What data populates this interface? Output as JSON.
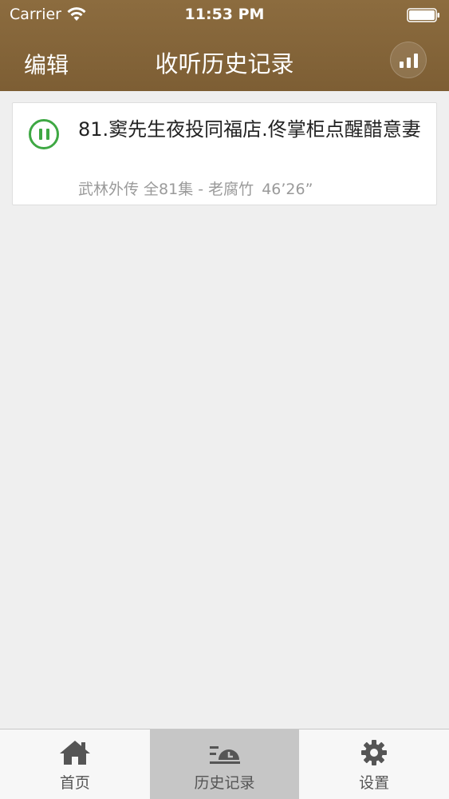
{
  "status_bar": {
    "carrier": "Carrier",
    "time": "11:53 PM"
  },
  "navbar": {
    "edit_label": "编辑",
    "title": "收听历史记录",
    "stats_icon": "bar-chart-icon"
  },
  "history": [
    {
      "title": "81.窦先生夜投同福店.佟掌柜点醒醋意妻",
      "show": "武林外传 全81集",
      "separator": "-",
      "author": "老腐竹",
      "duration": "46’26”",
      "state_icon": "pause-icon"
    }
  ],
  "tabs": [
    {
      "label": "首页",
      "icon": "home-icon",
      "active": false
    },
    {
      "label": "历史记录",
      "icon": "history-icon",
      "active": true
    },
    {
      "label": "设置",
      "icon": "gear-icon",
      "active": false
    }
  ],
  "colors": {
    "navbar": "#80613a",
    "accent_green": "#3ea843",
    "background": "#efefef",
    "active_tab": "#c6c6c6"
  }
}
